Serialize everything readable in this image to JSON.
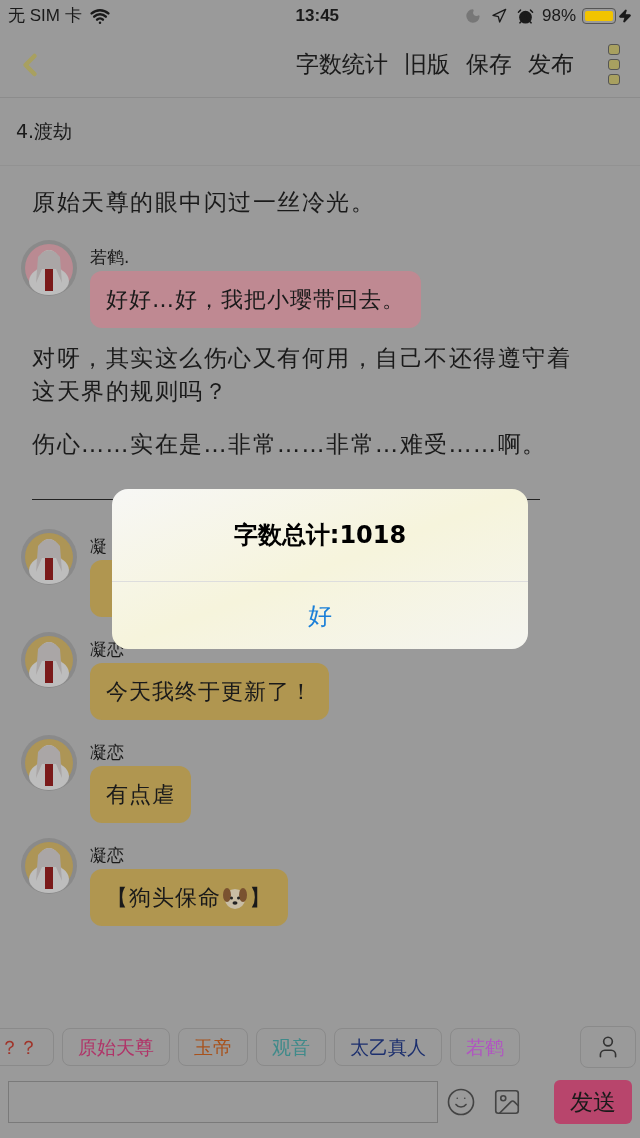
{
  "status_bar": {
    "carrier": "无 SIM 卡",
    "time": "13:45",
    "battery": "98%"
  },
  "nav": {
    "actions": [
      "字数统计",
      "旧版",
      "保存",
      "发布"
    ]
  },
  "chapter_title": "4.渡劫",
  "messages": [
    {
      "kind": "narration",
      "text": "原始天尊的眼中闪过一丝冷光。"
    },
    {
      "kind": "chat",
      "name": "若鹤.",
      "text": "好好…好，我把小璎带回去。",
      "color": "#bf8992"
    },
    {
      "kind": "narration",
      "text": "对呀，其实这么伤心又有何用，自己不还得遵守着这天界的规则吗？"
    },
    {
      "kind": "narration",
      "text": "伤心……实在是…非常……非常…难受……啊。"
    },
    {
      "kind": "divider"
    },
    {
      "kind": "chat",
      "name": "凝",
      "color": "#b09650"
    },
    {
      "kind": "chat",
      "name": "凝恋",
      "text": "今天我终于更新了！",
      "color": "#b09650"
    },
    {
      "kind": "chat",
      "name": "凝恋",
      "text": "有点虐",
      "color": "#b09650"
    },
    {
      "kind": "chat",
      "name": "凝恋",
      "text": "【狗头保命",
      "text_after": "】",
      "emoji": true,
      "color": "#b09650"
    }
  ],
  "role_tags": [
    {
      "label": "？？",
      "color": "#a0352b"
    },
    {
      "label": "原始天尊",
      "color": "#b03468"
    },
    {
      "label": "玉帝",
      "color": "#a8521c"
    },
    {
      "label": "观音",
      "color": "#3f8a8a"
    },
    {
      "label": "太乙真人",
      "color": "#1c2f6e"
    },
    {
      "label": "若鹤",
      "color": "#b056c0"
    }
  ],
  "send_button": "发送",
  "dialog": {
    "title": "字数总计:1018",
    "button": "好"
  }
}
